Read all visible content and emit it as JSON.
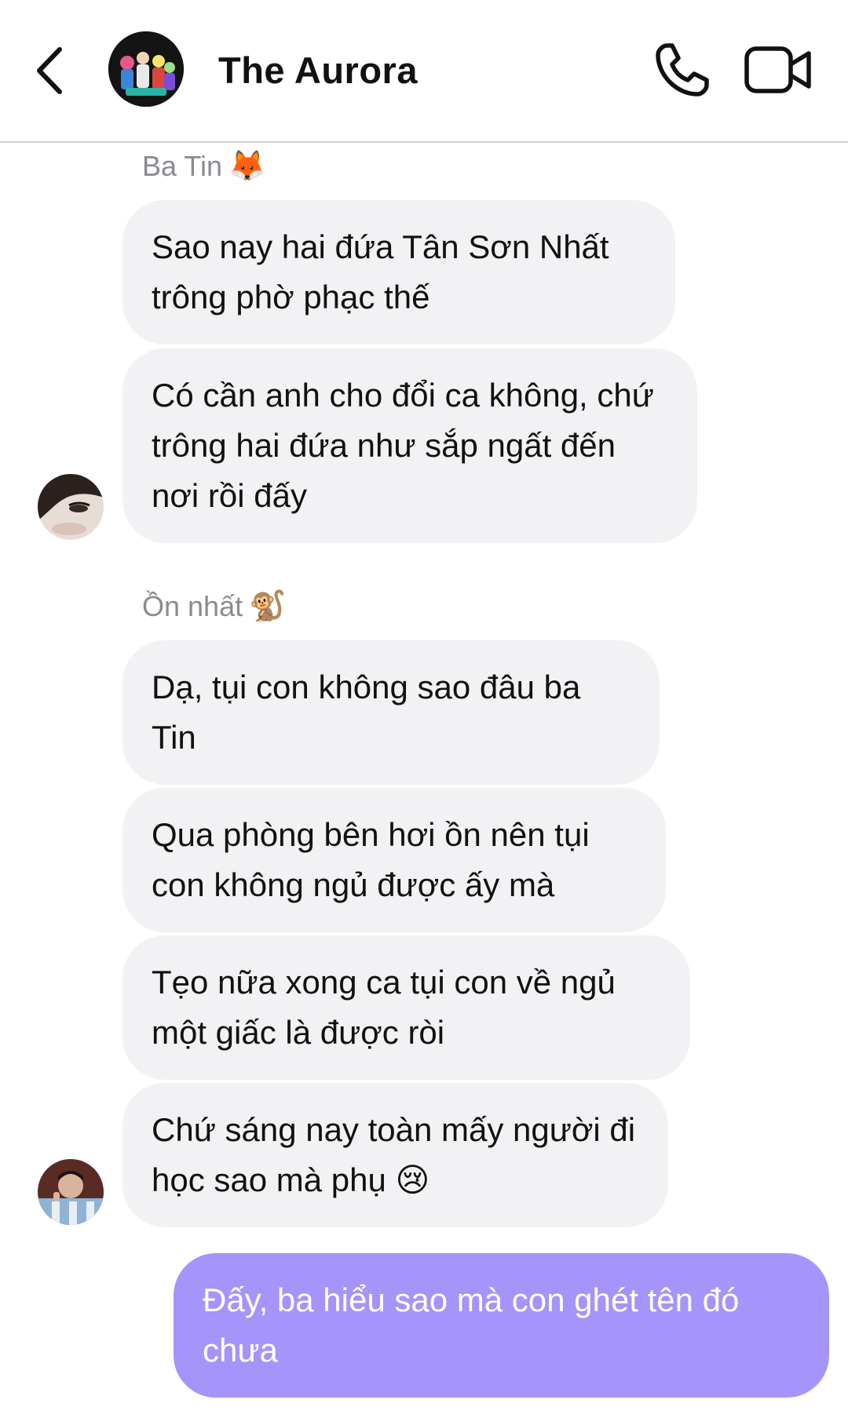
{
  "header": {
    "title": "The Aurora",
    "icons": {
      "back": "chevron-left-icon",
      "call": "phone-icon",
      "video": "video-camera-icon"
    }
  },
  "messages": [
    {
      "sender": "Ba Tin",
      "sender_emoji": "🦊",
      "bubbles": [
        "Sao nay hai đứa Tân Sơn Nhất trông phờ phạc thế",
        "Có cần anh cho đổi ca không, chứ trông hai đứa như sắp ngất đến nơi rồi đấy"
      ]
    },
    {
      "sender": "Ồn nhất",
      "sender_emoji": "🐒",
      "bubbles": [
        "Dạ, tụi con không sao đâu ba Tin",
        "Qua phòng bên hơi ồn nên tụi con không ngủ được ấy mà",
        "Tẹo nữa xong ca tụi con về ngủ một giấc là được ròi",
        "Chứ sáng nay toàn mấy người đi học sao mà phụ 😢"
      ]
    },
    {
      "sender": "me",
      "bubbles": [
        "Đấy, ba hiểu sao mà con ghét tên đó chưa"
      ]
    }
  ],
  "colors": {
    "incoming_bubble": "#f2f2f5",
    "outgoing_bubble": "#a594f9",
    "sender_name": "#8a8a90"
  }
}
